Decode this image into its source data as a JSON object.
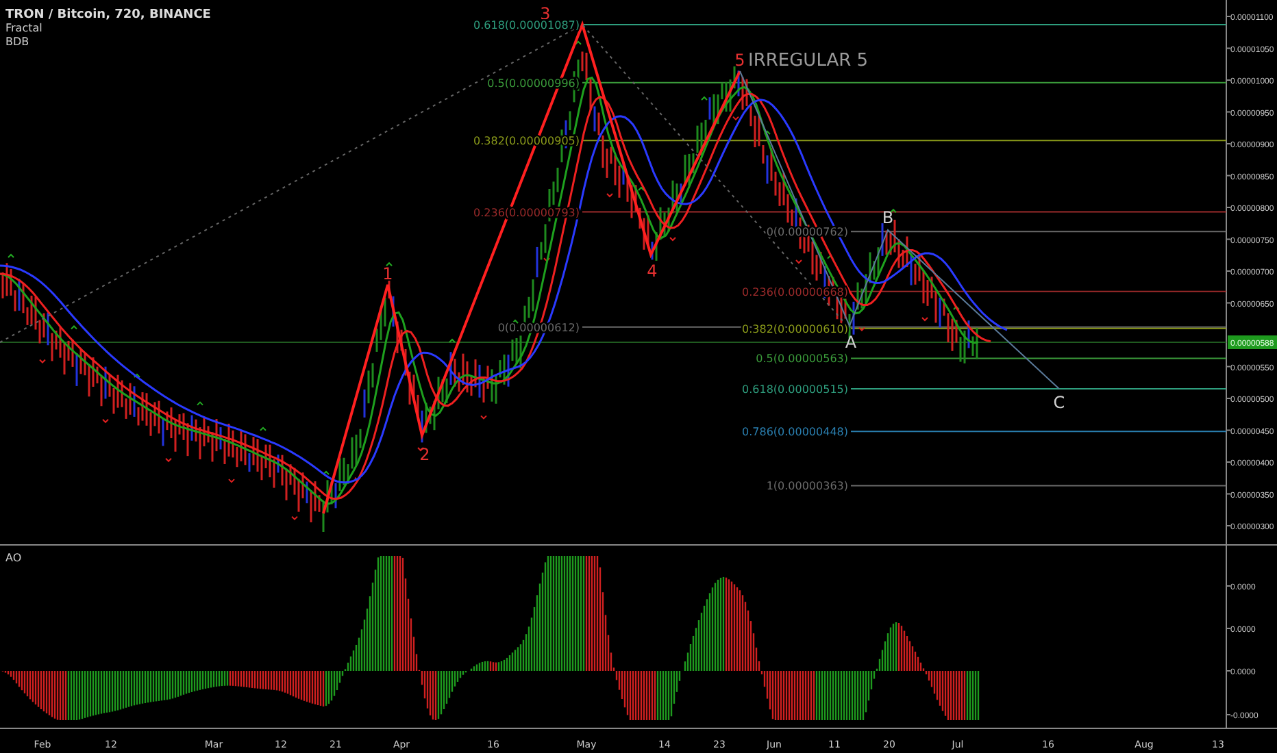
{
  "header": {
    "title": "TRON / Bitcoin, 720, BINANCE",
    "indicators": [
      "Fractal",
      "BDB"
    ]
  },
  "price_axis": {
    "labels": [
      "0.00001100",
      "0.00001050",
      "0.00001000",
      "0.00000950",
      "0.00000900",
      "0.00000850",
      "0.00000800",
      "0.00000750",
      "0.00000700",
      "0.00000650",
      "0.00000550",
      "0.00000500",
      "0.00000450",
      "0.00000400",
      "0.00000350",
      "0.00000300"
    ],
    "last_price": "0.00000588"
  },
  "fib_left": [
    {
      "label": "0.618(0.00001087)",
      "color": "#2e9e7e"
    },
    {
      "label": "0.5(0.00000996)",
      "color": "#3a9a3a"
    },
    {
      "label": "0.382(0.00000905)",
      "color": "#8a9a1a"
    },
    {
      "label": "0.236(0.00000793)",
      "color": "#9a2a2a"
    },
    {
      "label": "0(0.00000612)",
      "color": "#6a6a6a"
    }
  ],
  "fib_right": [
    {
      "label": "0(0.00000762)",
      "color": "#6a6a6a"
    },
    {
      "label": "0.236(0.00000668)",
      "color": "#9a2a2a"
    },
    {
      "label": "0.382(0.00000610)",
      "color": "#8a9a1a"
    },
    {
      "label": "0.5(0.00000563)",
      "color": "#3a9a3a"
    },
    {
      "label": "0.618(0.00000515)",
      "color": "#2e9e7e"
    },
    {
      "label": "0.786(0.00000448)",
      "color": "#2a7fb0"
    },
    {
      "label": "1(0.00000363)",
      "color": "#6a6a6a"
    }
  ],
  "wave_labels": [
    {
      "text": "1",
      "kind": "impulse"
    },
    {
      "text": "2",
      "kind": "impulse"
    },
    {
      "text": "3",
      "kind": "impulse"
    },
    {
      "text": "4",
      "kind": "impulse"
    },
    {
      "text": "5",
      "kind": "impulse"
    },
    {
      "text": "IRREGULAR 5",
      "kind": "note"
    },
    {
      "text": "A",
      "kind": "corrective"
    },
    {
      "text": "B",
      "kind": "corrective"
    },
    {
      "text": "C",
      "kind": "corrective"
    }
  ],
  "oscillator": {
    "name": "AO",
    "axis_labels": [
      "0.0000",
      "0.0000",
      "0.0000",
      "-0.0000"
    ]
  },
  "time_axis": {
    "labels": [
      "Feb",
      "12",
      "Mar",
      "12",
      "21",
      "Apr",
      "16",
      "May",
      "14",
      "23",
      "Jun",
      "11",
      "20",
      "Jul",
      "16",
      "Aug",
      "13"
    ]
  }
}
